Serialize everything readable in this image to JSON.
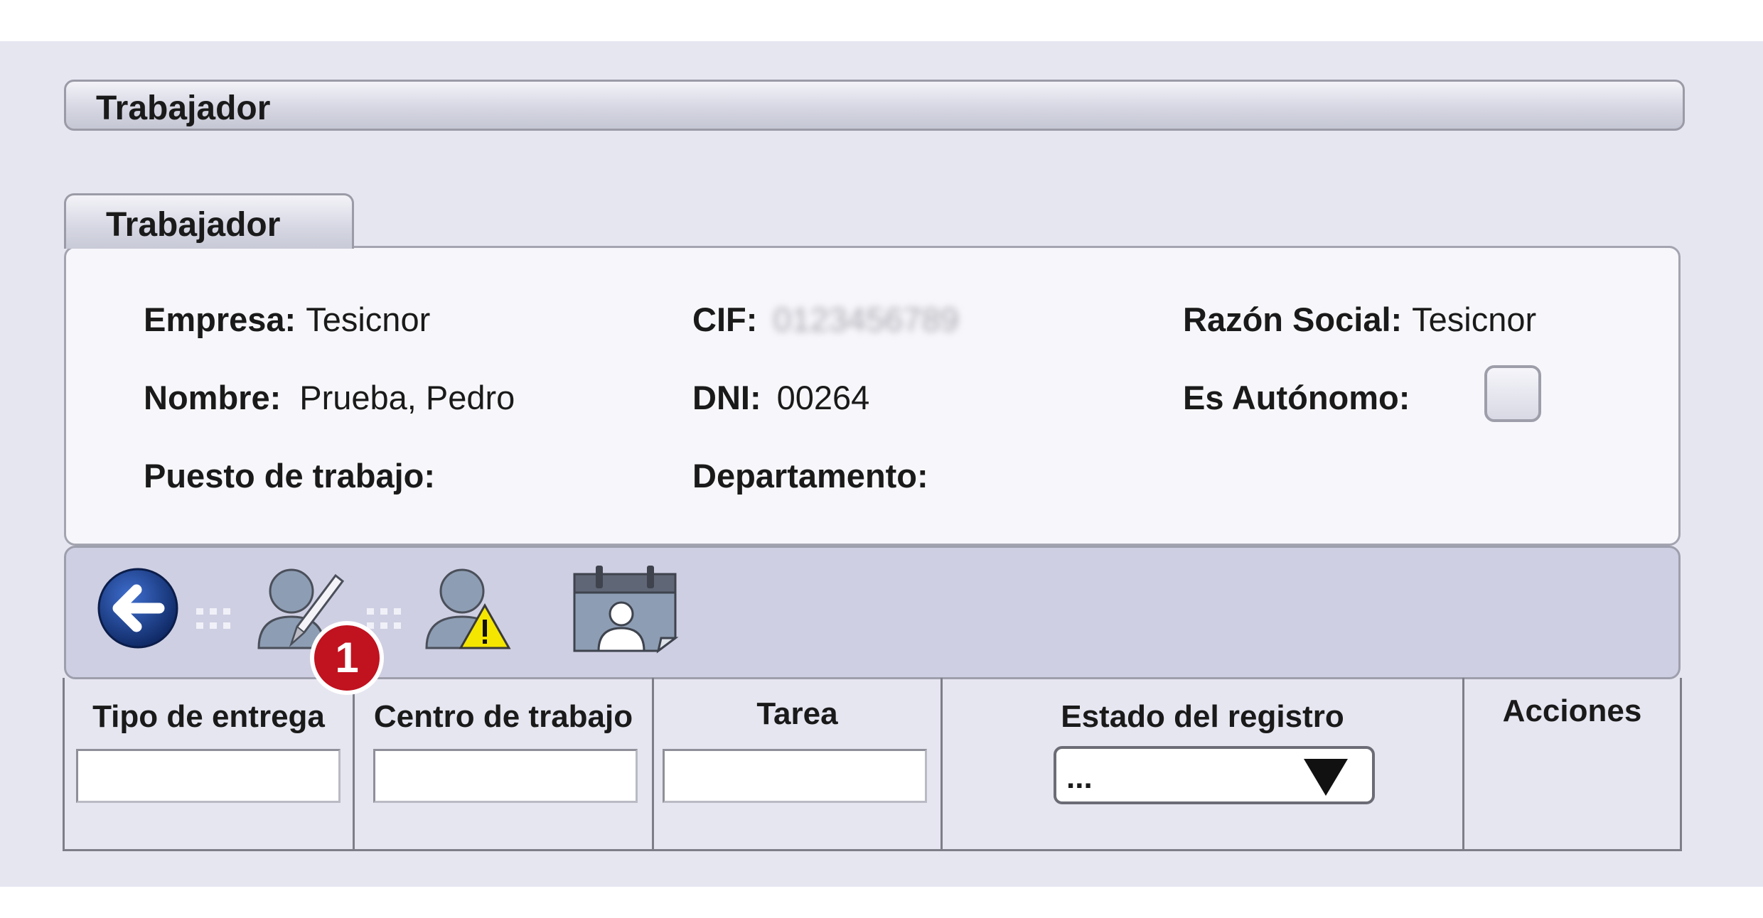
{
  "header": {
    "title": "Trabajador"
  },
  "tab": {
    "label": "Trabajador"
  },
  "worker": {
    "empresa_label": "Empresa:",
    "empresa_value": "Tesicnor",
    "cif_label": "CIF:",
    "cif_value": "0123456789",
    "razon_label": "Razón Social:",
    "razon_value": "Tesicnor",
    "nombre_label": "Nombre:",
    "nombre_value": "Prueba, Pedro",
    "dni_label": "DNI:",
    "dni_value": "00264",
    "autonomo_label": "Es Autónomo:",
    "autonomo_checked": false,
    "puesto_label": "Puesto de trabajo:",
    "departamento_label": "Departamento:"
  },
  "toolbar": {
    "icons": [
      "back-arrow-icon",
      "edit-user-icon",
      "user-warning-icon",
      "calendar-user-icon"
    ],
    "badge": "1",
    "badge_color": "#c1121f"
  },
  "table": {
    "columns": [
      {
        "header": "Tipo de entrega",
        "filter": "input",
        "value": ""
      },
      {
        "header": "Centro de trabajo",
        "filter": "input",
        "value": ""
      },
      {
        "header": "Tarea",
        "filter": "input",
        "value": ""
      },
      {
        "header": "Estado del registro",
        "filter": "select",
        "value": "..."
      },
      {
        "header": "Acciones",
        "filter": "none"
      }
    ]
  },
  "colors": {
    "frame": "#e6e6f1",
    "toolbar": "#cfcfe3",
    "back_button": "#1c3f8c"
  }
}
